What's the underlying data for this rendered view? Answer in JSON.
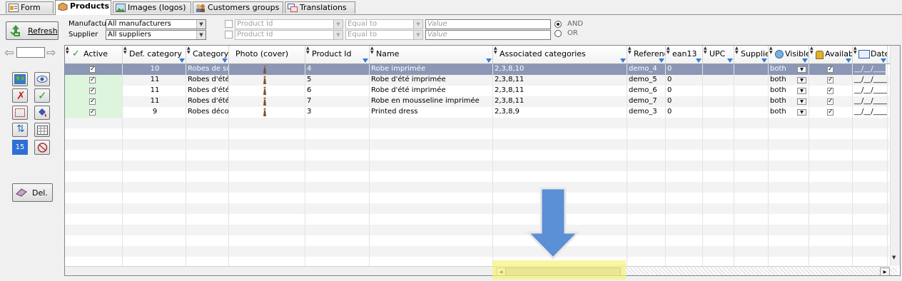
{
  "tabs": [
    {
      "label": "Form",
      "icon": "form-icon"
    },
    {
      "label": "Products",
      "icon": "products-icon",
      "active": true
    },
    {
      "label": "Images (logos)",
      "icon": "images-icon"
    },
    {
      "label": "Customers groups",
      "icon": "customers-groups-icon"
    },
    {
      "label": "Translations",
      "icon": "translations-icon"
    }
  ],
  "toolbar": {
    "refresh_label": "Refresh",
    "page_value": "",
    "count_badge": "15",
    "delete_label": "Del."
  },
  "filters": {
    "manufacturer_label": "Manufacturer",
    "manufacturer_value": "All manufacturers",
    "supplier_label": "Supplier",
    "supplier_value": "All suppliers",
    "rows": [
      {
        "field": "Product Id",
        "op": "Equal to",
        "value_placeholder": "Value"
      },
      {
        "field": "Product Id",
        "op": "Equal to",
        "value_placeholder": "Value"
      }
    ],
    "and_label": "AND",
    "or_label": "OR",
    "logic_selected": "AND"
  },
  "grid": {
    "columns": [
      "Active",
      "Def. category",
      "Category",
      "Photo (cover)",
      "Product Id",
      "Name",
      "Associated categories",
      "Reference",
      "ean13",
      "UPC",
      "Supplier",
      "Visible",
      "Available",
      "Date"
    ],
    "rows": [
      {
        "active": true,
        "def_category": "10",
        "category": "Robes de soirée",
        "photo": "dress",
        "product_id": "4",
        "name": "Robe imprimée",
        "associated": "2,3,8,10",
        "reference": "demo_4",
        "ean13": "0",
        "upc": "",
        "supplier": "",
        "visible": "both",
        "available": true,
        "date": "__/__/____",
        "selected": true
      },
      {
        "active": true,
        "def_category": "11",
        "category": "Robes d'été",
        "photo": "dress",
        "product_id": "5",
        "name": "Robe d'été imprimée",
        "associated": "2,3,8,11",
        "reference": "demo_5",
        "ean13": "0",
        "upc": "",
        "supplier": "",
        "visible": "both",
        "available": true,
        "date": "__/__/____"
      },
      {
        "active": true,
        "def_category": "11",
        "category": "Robes d'été",
        "photo": "dress",
        "product_id": "6",
        "name": "Robe d'été imprimée",
        "associated": "2,3,8,11",
        "reference": "demo_6",
        "ean13": "0",
        "upc": "",
        "supplier": "",
        "visible": "both",
        "available": true,
        "date": "__/__/____"
      },
      {
        "active": true,
        "def_category": "11",
        "category": "Robes d'été",
        "photo": "dress",
        "product_id": "7",
        "name": "Robe en mousseline imprimée",
        "associated": "2,3,8,11",
        "reference": "demo_7",
        "ean13": "0",
        "upc": "",
        "supplier": "",
        "visible": "both",
        "available": true,
        "date": "__/__/____"
      },
      {
        "active": true,
        "def_category": "9",
        "category": "Robes décontractées",
        "photo": "dress",
        "product_id": "3",
        "name": "Printed dress",
        "associated": "2,3,8,9",
        "reference": "demo_3",
        "ean13": "0",
        "upc": "",
        "supplier": "",
        "visible": "both",
        "available": true,
        "date": "__/__/____"
      }
    ]
  },
  "colors": {
    "selected_row": "#8b97b5",
    "active_column_bg": "#dcf5dc",
    "highlight": "#f7f27a",
    "arrow": "#5b8fd6"
  }
}
